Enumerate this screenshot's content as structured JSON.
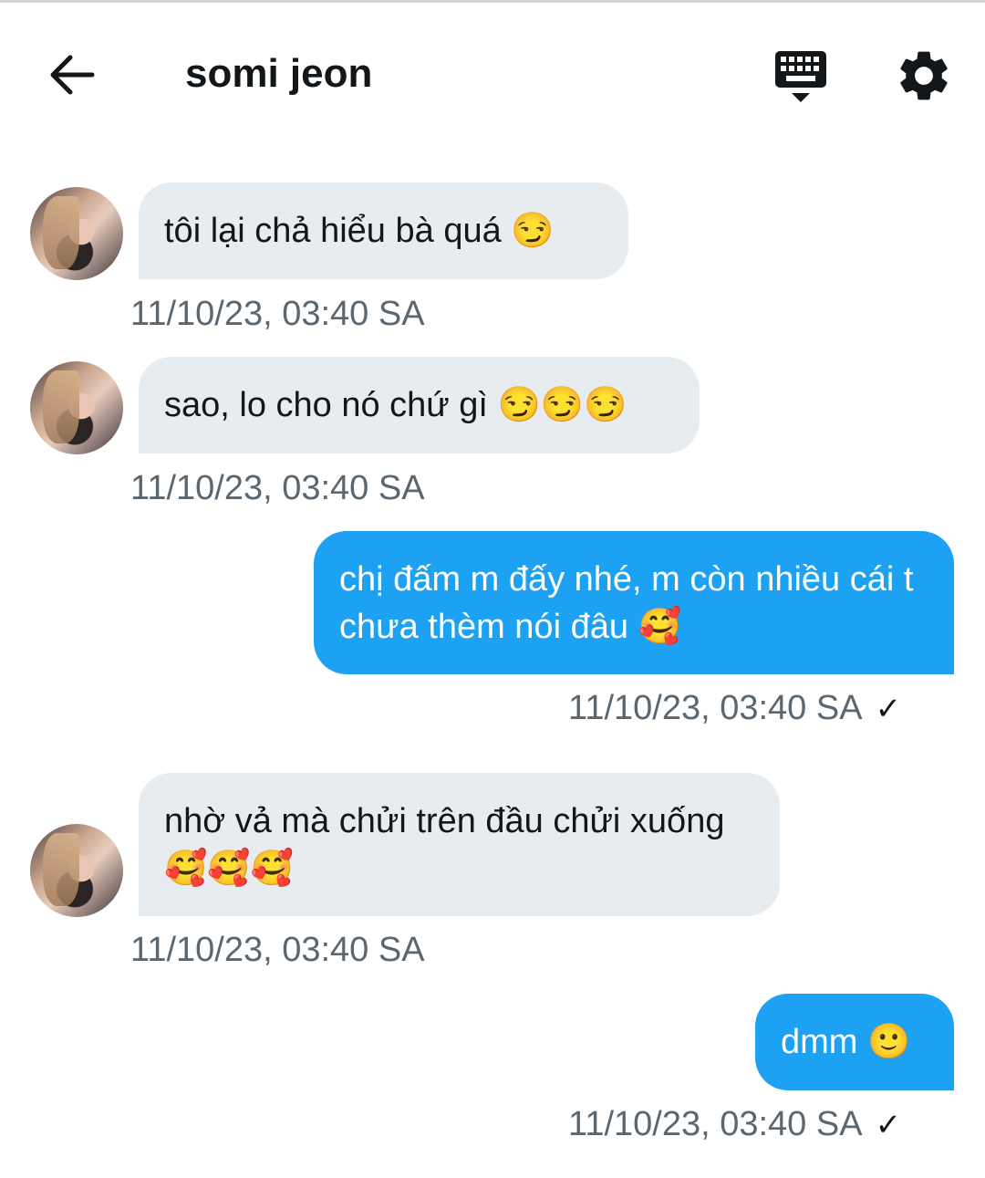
{
  "header": {
    "title": "somi jeon"
  },
  "messages": [
    {
      "from": "them",
      "text": "tôi lại chả hiểu bà quá 😏",
      "time": "11/10/23, 03:40 SA"
    },
    {
      "from": "them",
      "text": "sao, lo cho nó chứ gì 😏😏😏",
      "time": "11/10/23, 03:40 SA"
    },
    {
      "from": "me",
      "text": "chị đấm m đấy nhé, m còn nhiều cái t chưa thèm nói đâu 🥰",
      "time": "11/10/23, 03:40 SA",
      "status": "✓"
    },
    {
      "from": "them",
      "text": "nhờ vả mà chửi trên đầu chửi xuống 🥰🥰🥰",
      "time": "11/10/23, 03:40 SA"
    },
    {
      "from": "me",
      "text": "dmm 🙂",
      "time": "11/10/23, 03:40 SA",
      "status": "✓"
    }
  ],
  "colors": {
    "incoming_bubble": "#e6ecf0",
    "outgoing_bubble": "#1da1f2",
    "timestamp": "#5b6770"
  },
  "icons": [
    "back-arrow-icon",
    "keyboard-icon",
    "settings-gear-icon",
    "read-check-icon"
  ]
}
